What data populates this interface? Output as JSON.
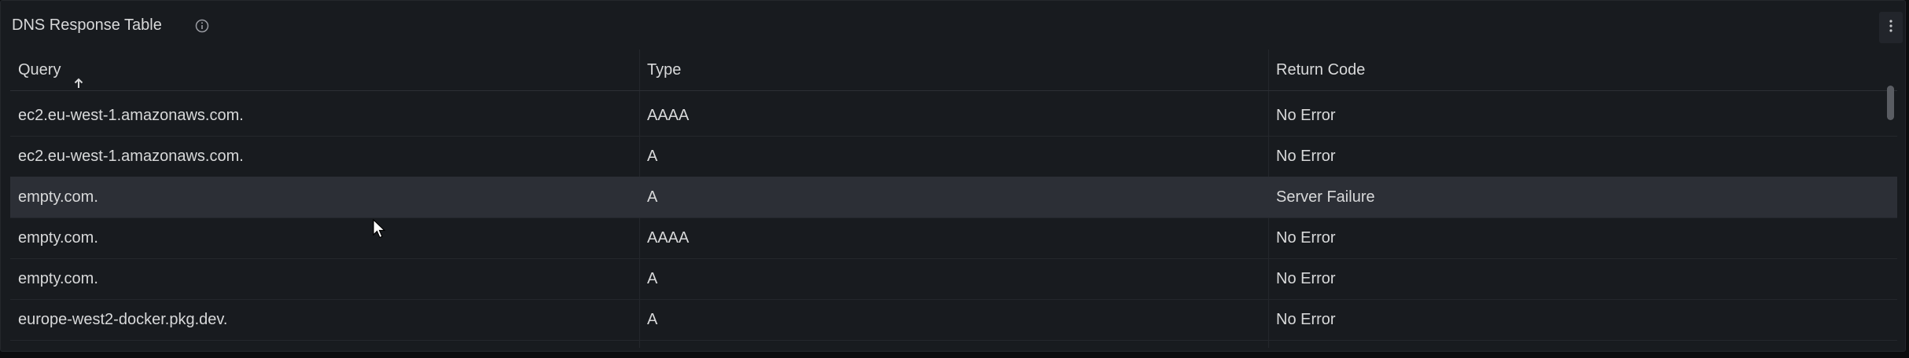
{
  "panel": {
    "title": "DNS Response Table",
    "info_icon": "info-circle-icon",
    "menu_icon": "vertical-ellipsis-icon"
  },
  "table": {
    "columns": [
      {
        "label": "Query",
        "sort": "ascending",
        "sort_icon": "arrow-up-icon"
      },
      {
        "label": "Type"
      },
      {
        "label": "Return Code"
      }
    ],
    "rows": [
      {
        "query": "ec2.eu-west-1.amazonaws.com.",
        "type": "AAAA",
        "return_code": "No Error"
      },
      {
        "query": "ec2.eu-west-1.amazonaws.com.",
        "type": "A",
        "return_code": "No Error"
      },
      {
        "query": "empty.com.",
        "type": "A",
        "return_code": "Server Failure"
      },
      {
        "query": "empty.com.",
        "type": "AAAA",
        "return_code": "No Error"
      },
      {
        "query": "empty.com.",
        "type": "A",
        "return_code": "No Error"
      },
      {
        "query": "europe-west2-docker.pkg.dev.",
        "type": "A",
        "return_code": "No Error"
      }
    ],
    "highlighted_row": 2
  },
  "colors": {
    "panel_bg": "#181b1f",
    "row_hover": "#2c2f36",
    "text": "#d8d9da"
  }
}
